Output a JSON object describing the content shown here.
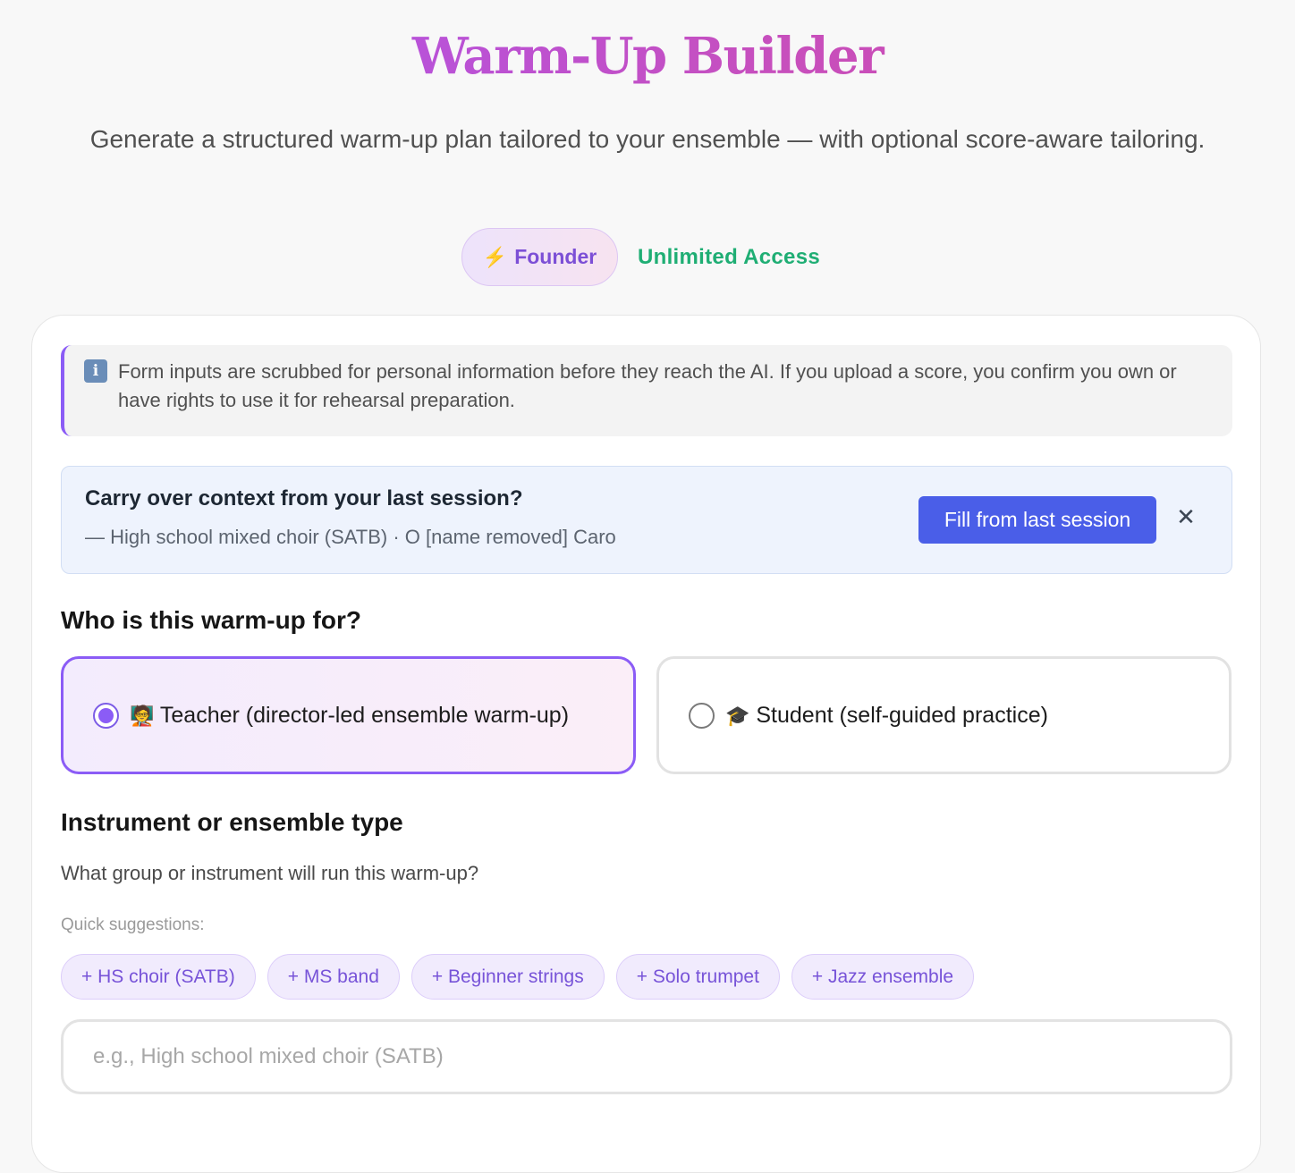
{
  "header": {
    "title": "Warm-Up Builder",
    "subtitle": "Generate a structured warm-up plan tailored to your ensemble — with optional score-aware tailoring.",
    "badge": {
      "icon": "lightning-bolt-icon",
      "label": "Founder"
    },
    "access_label": "Unlimited Access"
  },
  "notice": {
    "icon": "info-icon",
    "icon_glyph": "i",
    "text": "Form inputs are scrubbed for personal information before they reach the AI. If you upload a score, you confirm you own or have rights to use it for rehearsal preparation."
  },
  "carry_over": {
    "title": "Carry over context from your last session?",
    "detail": "— High school mixed choir (SATB) · O [name removed] Caro",
    "button_label": "Fill from last session",
    "close_glyph": "✕"
  },
  "audience": {
    "heading": "Who is this warm-up for?",
    "options": [
      {
        "emoji": "🧑‍🏫",
        "label": "Teacher (director-led ensemble warm-up)",
        "selected": true
      },
      {
        "emoji": "🎓",
        "label": "Student (self-guided practice)",
        "selected": false
      }
    ]
  },
  "ensemble": {
    "heading": "Instrument or ensemble type",
    "helper": "What group or instrument will run this warm-up?",
    "quick_label": "Quick suggestions:",
    "suggestions": [
      "+ HS choir (SATB)",
      "+ MS band",
      "+ Beginner strings",
      "+ Solo trumpet",
      "+ Jazz ensemble"
    ],
    "input_value": "",
    "input_placeholder": "e.g., High school mixed choir (SATB)"
  },
  "colors": {
    "title_gradient_start": "#a855f7",
    "title_gradient_end": "#d24aa8",
    "accent_purple": "#8b5cf6",
    "access_green": "#1fae74",
    "primary_button": "#4a5ee8",
    "carry_background": "#eef3fd"
  }
}
